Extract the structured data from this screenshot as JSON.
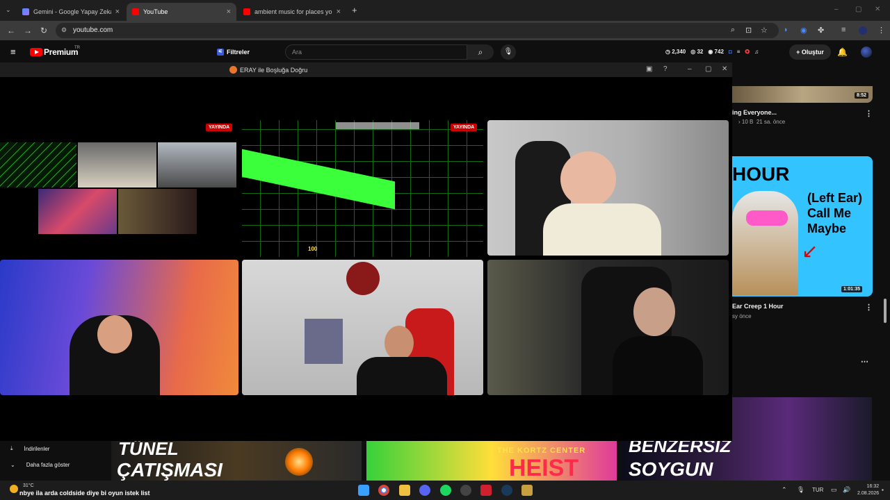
{
  "browser": {
    "tabs": [
      {
        "label": "Gemini - Google Yapay Zeka'ya",
        "active": false
      },
      {
        "label": "YouTube",
        "active": true
      },
      {
        "label": "ambient music for places you s",
        "active": false
      }
    ],
    "new_tab": "+",
    "url": "youtube.com"
  },
  "youtube": {
    "logo_text": "Premium",
    "logo_sup": "TR",
    "filters_label": "Filtreler",
    "search_placeholder": "Ara",
    "stats": {
      "time": "2,340",
      "coins": "32",
      "views": "742"
    },
    "create_label": "Oluştur"
  },
  "popup": {
    "title": "ERAY ile Boşluğa Doğru",
    "live_badge_1": "YAYINDA",
    "live_badge_2": "YAYINDA",
    "hud_number": "100"
  },
  "sidebar_videos": [
    {
      "title": "ing Everyone...",
      "meta_views": "10 B",
      "meta_age": "21 sa. önce",
      "duration": "8:52"
    },
    {
      "title": "Ear Creep 1 Hour",
      "meta_age": "sy önce",
      "duration": "1:01:35",
      "thumb_text_big": "HOUR",
      "thumb_text_1": "(Left Ear)",
      "thumb_text_2": "Call Me",
      "thumb_text_3": "Maybe"
    }
  ],
  "bottom_row": {
    "thumb1_line1": "TÜNEL",
    "thumb1_line2": "ÇATIŞMASI",
    "thumb2_line1": "THE KORTZ CENTER",
    "thumb2_line2": "HEIST",
    "thumb3_line1": "BENZERSİZ",
    "thumb3_line2": "SOYGUN"
  },
  "left_nav": [
    {
      "label": "İndirilenler",
      "icon": "download-icon"
    },
    {
      "label": "Daha fazla göster",
      "icon": "chevron-down-icon"
    }
  ],
  "taskbar": {
    "temperature": "31°C",
    "ticker": "nbye ila arda coldside diye bi oyun istek list",
    "language": "TUR",
    "time": "16:32",
    "date": "2.08.2026"
  },
  "colors": {
    "accent_red": "#ff0000",
    "live_red": "#cc0000",
    "bg": "#0f0f0f"
  }
}
